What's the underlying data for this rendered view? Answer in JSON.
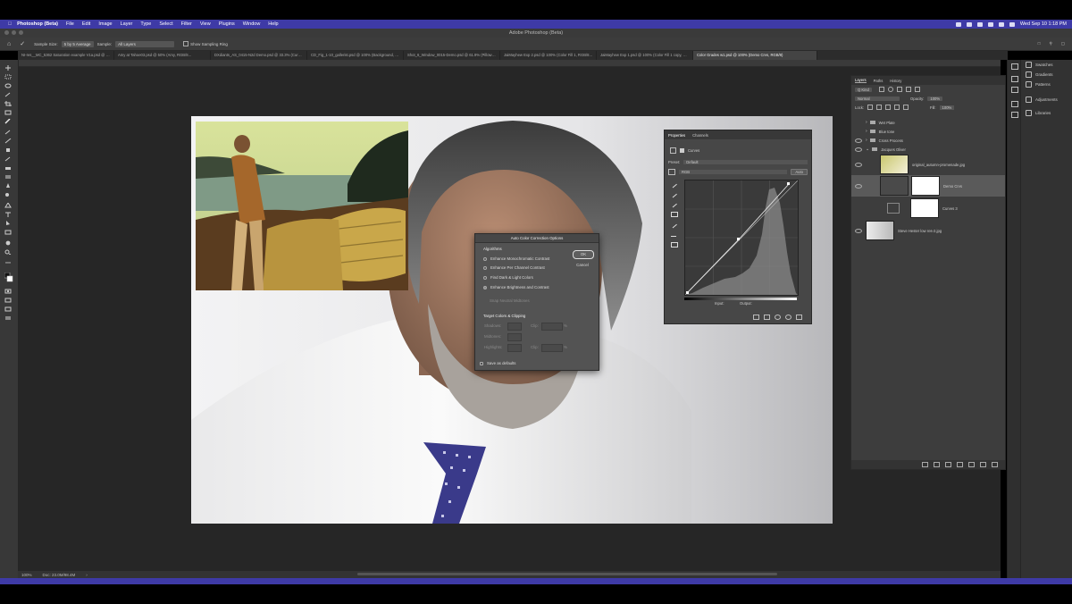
{
  "menubar": {
    "app": "Photoshop (Beta)",
    "items": [
      "File",
      "Edit",
      "Image",
      "Layer",
      "Type",
      "Select",
      "Filter",
      "View",
      "Plugins",
      "Window",
      "Help"
    ],
    "clock": "Wed Sep 10  1:18 PM"
  },
  "window": {
    "title": "Adobe Photoshop (Beta)"
  },
  "options": {
    "sample_size_label": "Sample Size:",
    "sample_size_value": "5 by 5 Average",
    "sample_label": "Sample:",
    "sample_value": "All Layers",
    "show_ring_label": "Show Sampling Ring"
  },
  "tabs": [
    "NI-res__MC_5362 Saturation example V1a.psd @ 100% (De...",
    "Amy at Tahoe03.psd @ 50% (Amy, RGB/8...",
    "DXdiants_AS_0415-N2d Demo.psd @ 33.3% (Curves 1, Laye...",
    "CD_Fig_1-10_gallerist.psd @ 100% (Background, RGB/...",
    "Shot_6_Window_0015-Demo.psd @ 61.9% (Pillow Hue/Sat, ...",
    "JaiMayhew Exp 2.psd @ 100% (Color Fill 1, RGB/8...",
    "JaiMayhew Exp 1.psd @ 100% (Color Fill 1 copy, RGB/...",
    "Color Grades w1.psd @ 100% (Demo Crvs, RGB/8)"
  ],
  "active_tab": 7,
  "status": {
    "zoom": "100%",
    "doc": "Doc: 23.0M/98.4M"
  },
  "right_dock": {
    "items": [
      "Swatches",
      "Gradients",
      "Patterns",
      "Adjustments",
      "Libraries"
    ]
  },
  "layers": {
    "tabs": [
      "Layers",
      "Paths",
      "History"
    ],
    "kind": "Q Kind",
    "blend": "Normal",
    "opacity_label": "Opacity:",
    "opacity": "100%",
    "lock_label": "Lock:",
    "fill_label": "Fill:",
    "fill": "100%",
    "rows": [
      {
        "name": "Wet Plate",
        "type": "group"
      },
      {
        "name": "Blue tone",
        "type": "group"
      },
      {
        "name": "Cross Process",
        "type": "group"
      },
      {
        "name": "Jacques Oliver",
        "type": "group"
      },
      {
        "name": "original_autumn-promenade.jpg",
        "type": "image"
      },
      {
        "name": "Demo Crvs",
        "type": "adjust"
      },
      {
        "name": "Curves 3",
        "type": "adjust"
      },
      {
        "name": "Steve Hester low res-2.jpg",
        "type": "image"
      }
    ]
  },
  "properties": {
    "tabs": [
      "Properties",
      "Channels"
    ],
    "type": "Curves",
    "preset_label": "Preset:",
    "preset": "Default",
    "channel": "RGB",
    "auto": "Auto",
    "input_label": "Input:",
    "output_label": "Output:"
  },
  "dialog": {
    "title": "Auto Color Correction Options",
    "algorithms_label": "Algorithms",
    "options": [
      "Enhance Monochromatic Contrast",
      "Enhance Per Channel Contrast",
      "Find Dark & Light Colors",
      "Enhance Brightness and Contrast"
    ],
    "selected": 3,
    "snap_label": "Snap Neutral Midtones",
    "target_label": "Target Colors & Clipping",
    "shadows_label": "Shadows:",
    "midtones_label": "Midtones:",
    "highlights_label": "Highlights:",
    "clip_label": "Clip:",
    "clip_unit": "%",
    "save_label": "Save as defaults",
    "ok": "OK",
    "cancel": "Cancel"
  }
}
